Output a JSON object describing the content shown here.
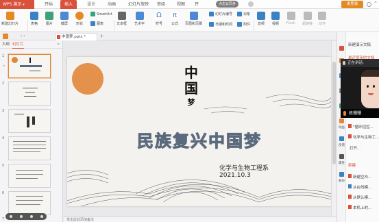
{
  "app": {
    "name": "WPS 演示",
    "cloud": "点击云同步",
    "login": "未登录"
  },
  "menu": [
    "开始",
    "插入",
    "设计",
    "动画",
    "幻灯片放映",
    "审阅",
    "视图",
    "开发工具"
  ],
  "ribbon": {
    "new_slide": "新建幻灯片",
    "table": "表格",
    "picture": "图片",
    "screenshot": "截屏",
    "shape": "形状",
    "smartart": "SmartArt",
    "chart": "图表",
    "textbox": "文本框",
    "wordart": "艺术字",
    "symbol": "符号",
    "formula": "公式",
    "header_footer": "页眉和页脚",
    "slide_number": "幻灯片编号",
    "date_time": "日期和时间",
    "object": "对象",
    "attachment": "附件",
    "audio": "音频",
    "video": "视频",
    "flash": "Flash",
    "hyperlink": "超链接",
    "action": "动作"
  },
  "doc_tab": {
    "name": "中国梦.pptx *"
  },
  "left_panel": {
    "outline_tab": "大纲",
    "slides_tab": "幻灯片",
    "slide_numbers": [
      "1",
      "2",
      "3",
      "4",
      "5",
      "6",
      "7"
    ]
  },
  "slide": {
    "title_chars": [
      "中",
      "国",
      "梦"
    ],
    "headline": "民族复兴中国梦",
    "department": "化学与生物工程系",
    "date": "2021.10.3"
  },
  "notes_placeholder": "单击此处添加备注",
  "right_panel": {
    "header": "新建演示文稿",
    "recent": "最近使用的文档",
    "recent_items": [
      "\"循环招控...",
      "化学与生物工..."
    ],
    "open": "打开...",
    "new_section": "新建",
    "new_items": [
      "新建空白...",
      "从在线模...",
      "从默认模...",
      "本机上的..."
    ],
    "side_labels": [
      "动画",
      "反馈",
      "属性",
      "备份"
    ]
  },
  "video_call": {
    "status": "正在讲话:",
    "speaker": "练珊珊"
  },
  "colors": {
    "accent": "#d9513b",
    "orange": "#e2863a",
    "headline": "#5a6a7c"
  }
}
